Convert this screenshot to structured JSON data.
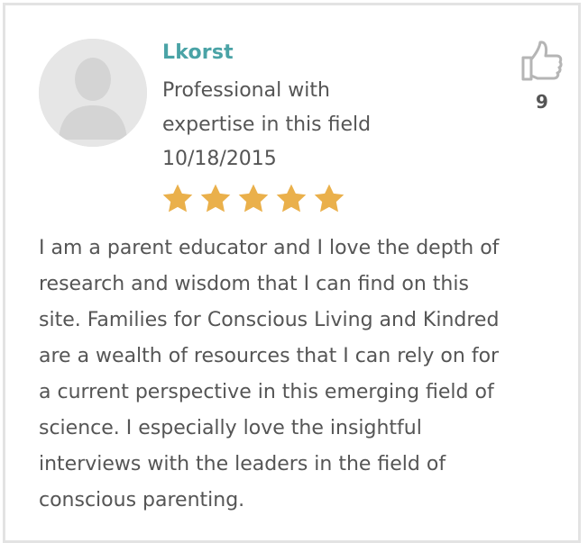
{
  "review": {
    "username": "Lkorst",
    "credential_lines": [
      "Professional with",
      "expertise in this field"
    ],
    "date": "10/18/2015",
    "rating": 5,
    "rating_max": 5,
    "like_count": "9",
    "body_lines": [
      "I am a parent educator and I love the depth of",
      "research and wisdom that I can find on this",
      "site. Families for Conscious Living and Kindred",
      "are a wealth of resources that I can rely on for",
      "a current perspective in this emerging field of",
      "science. I especially love the insightful",
      "interviews with the leaders in the field of",
      "conscious parenting."
    ]
  },
  "icons": {
    "avatar": "default-user-avatar",
    "like": "thumbs-up-icon",
    "star": "star-icon"
  },
  "colors": {
    "username": "#4aa3a6",
    "star": "#eab04b",
    "text": "#555555",
    "avatar_bg": "#e6e6e6",
    "avatar_figure": "#d4d4d4",
    "border": "#e3e3e3"
  }
}
